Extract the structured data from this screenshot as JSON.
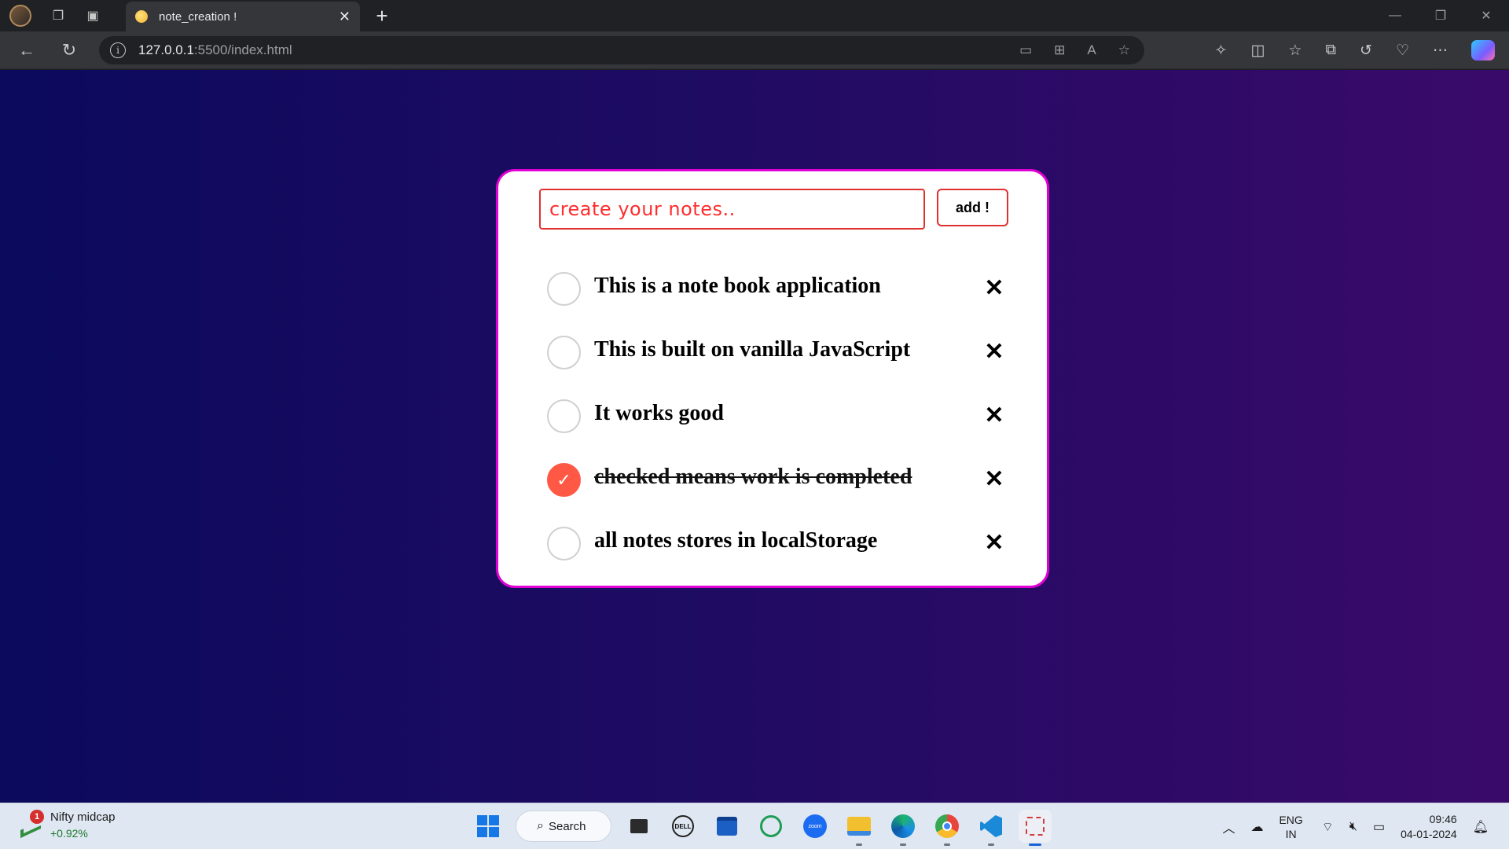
{
  "browser": {
    "tab_title": "note_creation !",
    "url_host": "127.0.0.1",
    "url_path": ":5500/index.html"
  },
  "app": {
    "input_placeholder": "create your notes..",
    "add_label": "add !",
    "notes": [
      {
        "text": "This is a note book application",
        "checked": false
      },
      {
        "text": "This is built on vanilla JavaScript",
        "checked": false
      },
      {
        "text": "It works good",
        "checked": false
      },
      {
        "text": "checked means work is completed",
        "checked": true
      },
      {
        "text": "all notes stores in localStorage",
        "checked": false
      }
    ],
    "delete_glyph": "✕",
    "check_glyph": "✓"
  },
  "taskbar": {
    "widget_title": "Nifty midcap",
    "widget_value": "+0.92%",
    "widget_badge": "1",
    "search_label": "Search",
    "lang_top": "ENG",
    "lang_bottom": "IN",
    "time": "09:46",
    "date": "04-01-2024"
  },
  "colors": {
    "card_border": "#e100d3",
    "input_border": "#e03131",
    "checked_fill": "#ff5945",
    "page_gradient_start": "#0b0a5c",
    "page_gradient_end": "#3a0a6a"
  }
}
